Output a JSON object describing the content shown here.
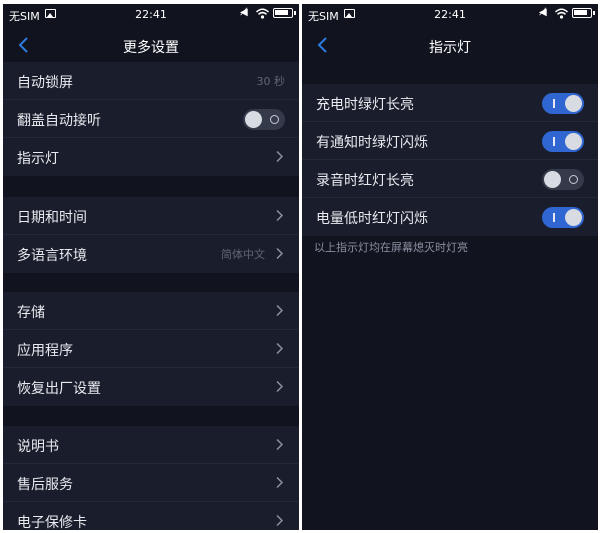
{
  "status_bar": {
    "carrier": "无SIM",
    "time": "22:41"
  },
  "left_screen": {
    "title": "更多设置",
    "groups": [
      [
        {
          "label": "自动锁屏",
          "value": "30 秒"
        },
        {
          "label": "翻盖自动接听",
          "toggle": "off"
        },
        {
          "label": "指示灯"
        }
      ],
      [
        {
          "label": "日期和时间"
        },
        {
          "label": "多语言环境",
          "value": "简体中文"
        }
      ],
      [
        {
          "label": "存储"
        },
        {
          "label": "应用程序"
        },
        {
          "label": "恢复出厂设置"
        }
      ],
      [
        {
          "label": "说明书"
        },
        {
          "label": "售后服务"
        },
        {
          "label": "电子保修卡"
        }
      ]
    ]
  },
  "right_screen": {
    "title": "指示灯",
    "items": [
      {
        "label": "充电时绿灯长亮",
        "toggle": "on"
      },
      {
        "label": "有通知时绿灯闪烁",
        "toggle": "on"
      },
      {
        "label": "录音时红灯长亮",
        "toggle": "off"
      },
      {
        "label": "电量低时红灯闪烁",
        "toggle": "on"
      }
    ],
    "footnote": "以上指示灯均在屏幕熄灭时灯亮"
  },
  "colors": {
    "background": "#11141f",
    "row": "#1a1e2c",
    "accent": "#2f66d2",
    "back_icon": "#2e7be0"
  },
  "icons": [
    "photo-icon",
    "mute-icon",
    "wifi-icon",
    "battery-icon",
    "back-icon",
    "chevron-right-icon"
  ]
}
